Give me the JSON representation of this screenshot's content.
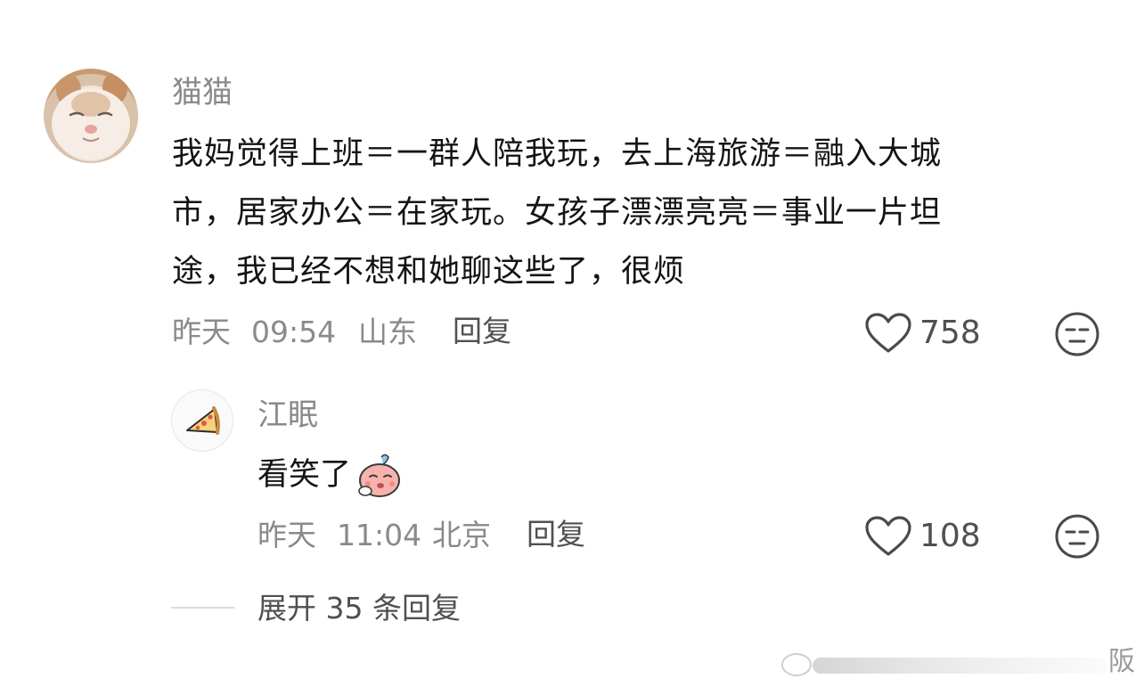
{
  "comment": {
    "username": "猫猫",
    "lines": [
      "我妈觉得上班＝一群人陪我玩，去上海旅游＝融入大城",
      "市，居家办公＝在家玩。女孩子漂漂亮亮＝事业一片坦",
      "途，我已经不想和她聊这些了，很烦"
    ],
    "date": "昨天",
    "time": "09:54",
    "location": "山东",
    "reply_label": "回复",
    "likes": "758",
    "icons": {
      "avatar": "cat-avatar",
      "like": "heart-icon",
      "dislike": "unamused-face-icon"
    }
  },
  "reply": {
    "username": "江眠",
    "text": "看笑了",
    "emoji": "sweating-blush-emoji",
    "date": "昨天",
    "time": "11:04",
    "location": "北京",
    "reply_label": "回复",
    "likes": "108",
    "icons": {
      "avatar": "pizza-icon",
      "like": "heart-icon",
      "dislike": "unamused-face-icon"
    }
  },
  "expand_label": "展开 35 条回复",
  "watermark_char": "阪",
  "colors": {
    "text": "#141414",
    "secondary": "#8a8a8a",
    "action": "#505050",
    "divider": "#dcdcdc",
    "background": "#ffffff"
  }
}
